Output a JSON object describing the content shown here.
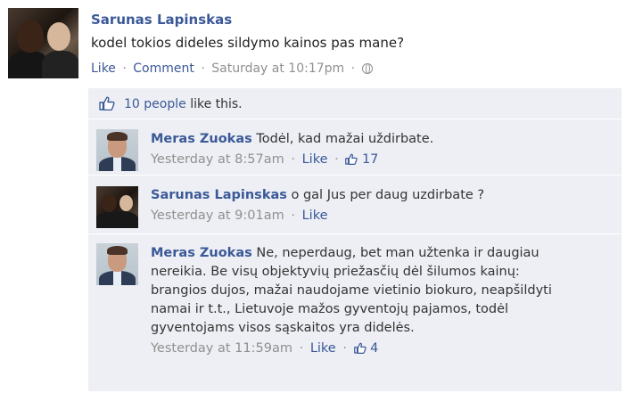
{
  "post": {
    "author": "Sarunas Lapinskas",
    "text": "kodel tokios dideles sildymo kainos pas mane?",
    "like_label": "Like",
    "comment_label": "Comment",
    "timestamp": "Saturday at 10:17pm",
    "separator": "·"
  },
  "likes": {
    "count_text": "10 people",
    "suffix": "like this."
  },
  "comments": [
    {
      "author": "Meras Zuokas",
      "text": "Todėl, kad mažai uždirbate.",
      "timestamp": "Yesterday at 8:57am",
      "like_label": "Like",
      "like_count": "17"
    },
    {
      "author": "Sarunas Lapinskas",
      "text": "o gal Jus per daug uzdirbate ?",
      "timestamp": "Yesterday at 9:01am",
      "like_label": "Like"
    },
    {
      "author": "Meras Zuokas",
      "text": "Ne, neperdaug, bet man užtenka ir daugiau nereikia. Be visų objektyvių priežasčių dėl šilumos kainų: brangios dujos, mažai naudojame vietinio biokuro, neapšildyti namai ir t.t., Lietuvoje mažos gyventojų pajamos, todėl gyventojams visos sąskaitos yra didelės.",
      "timestamp": "Yesterday at 11:59am",
      "like_label": "Like",
      "like_count": "4"
    }
  ],
  "colors": {
    "link": "#3b5998",
    "meta": "#909090",
    "ufi_background": "#edeff4"
  },
  "icons": [
    "thumbs-up-icon",
    "globe-icon"
  ]
}
